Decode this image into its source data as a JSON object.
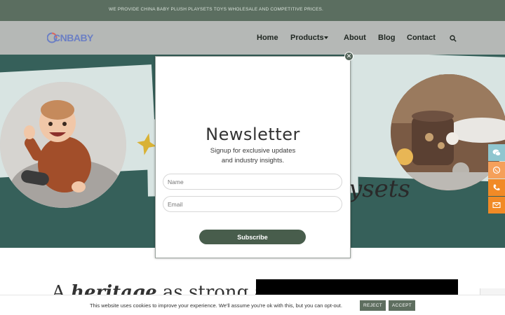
{
  "topbar": {
    "text": "WE PROVIDE CHINA BABY PLUSH PLAYSETS TOYS WHOLESALE AND COMPETITIVE PRICES."
  },
  "header": {
    "logo_text": "CNBABY",
    "nav": [
      "Home",
      "Products",
      "About",
      "Blog",
      "Contact"
    ]
  },
  "hero": {
    "script_text": "ysets"
  },
  "floating": {
    "icons": [
      "wechat-icon",
      "whatsapp-icon",
      "phone-icon",
      "mail-icon"
    ],
    "colors": [
      "#8fc6cf",
      "#f5a05a",
      "#f18a26",
      "#f18a26"
    ]
  },
  "section": {
    "heritage_pre": "A",
    "heritage_bold": "heritage",
    "heritage_post": "as strong as"
  },
  "cookie": {
    "text": "This website uses cookies to improve your experience. We'll assume you're ok with this, but you can opt-out.",
    "reject_label": "REJECT",
    "accept_label": "ACCEPT"
  },
  "modal": {
    "title": "Newsletter",
    "subtitle_line1": "Signup for exclusive updates",
    "subtitle_line2": "and industry insights.",
    "name_placeholder": "Name",
    "email_placeholder": "Email",
    "button_label": "Subscribe"
  },
  "colors": {
    "topbar": "#5b6e60",
    "hero": "#36605a",
    "brand_button": "#485d4c",
    "overlay": "#b5b8b6"
  }
}
